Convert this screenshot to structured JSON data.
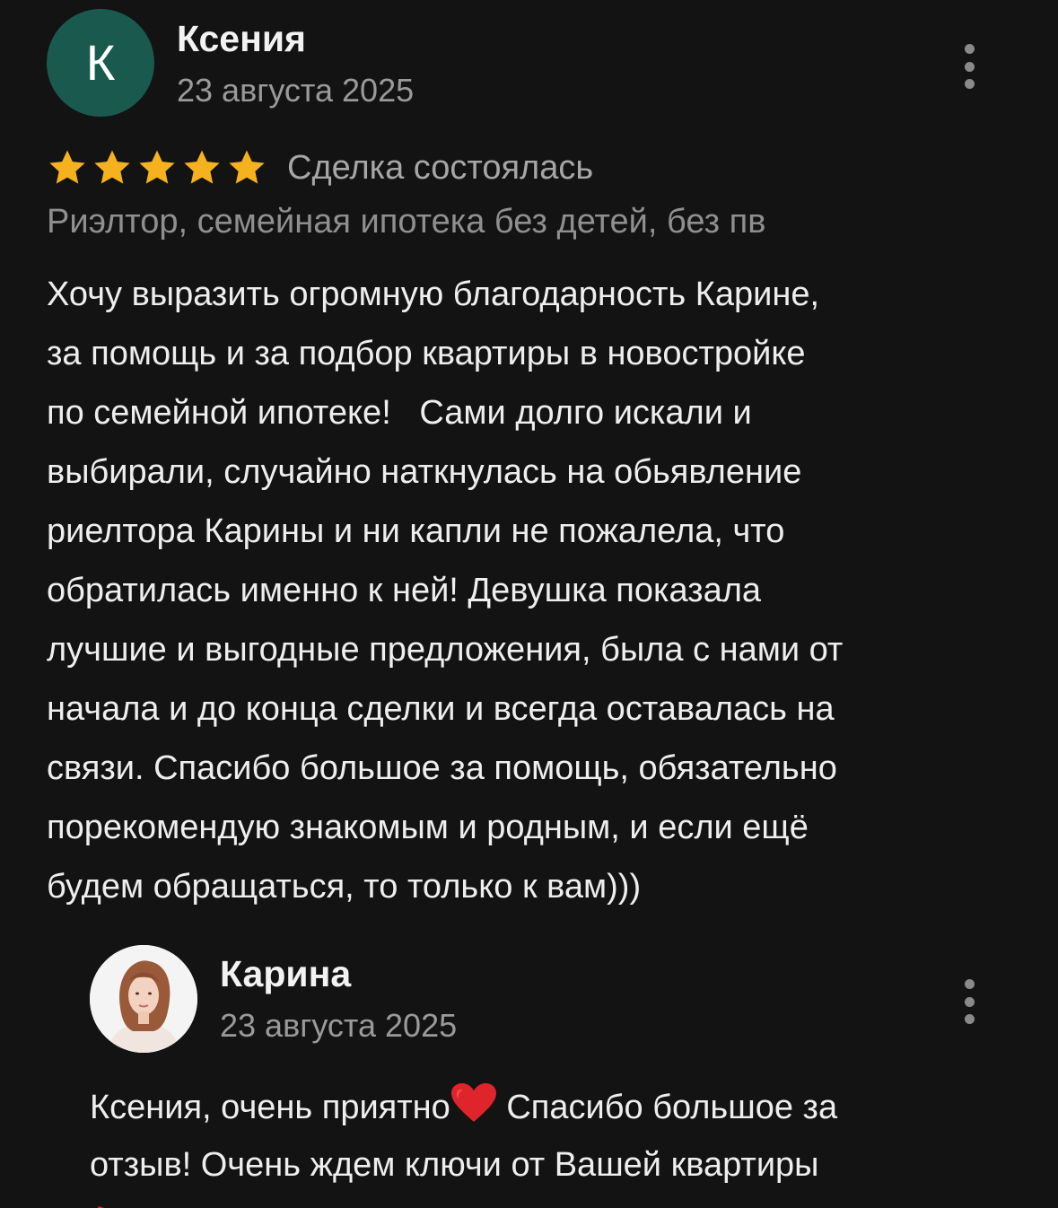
{
  "review": {
    "avatar_letter": "К",
    "author": "Ксения",
    "date": "23 августа 2025",
    "rating": 5,
    "rating_max": 5,
    "status": "Сделка состоялась",
    "subtitle": "Риэлтор, семейная ипотека без детей, без пв",
    "text_lines": [
      "Хочу выразить огромную благодарность Карине,",
      "за помощь и за подбор квартиры в новостройке",
      "по семейной ипотеке!   Сами долго искали и",
      "выбирали, случайно наткнулась на обьявление",
      "риелтора Карины и ни капли не пожалела, что",
      "обратилась именно к ней! Девушка показала",
      "лучшие и выгодные предложения, была с нами от",
      "начала и до конца сделки и всегда оставалась на",
      "связи. Спасибо большое за помощь, обязательно",
      "порекомендую знакомым и родным, и если ещё",
      "будем обращаться, то только к вам)))"
    ]
  },
  "reply": {
    "author": "Карина",
    "date": "23 августа 2025",
    "text_line1_before_emoji": "Ксения, очень приятно",
    "text_line1_after_emoji": " Спасибо большое за",
    "text_line2": "отзыв! Очень ждем ключи от Вашей квартиры"
  },
  "icons": {
    "star": "star-icon",
    "more": "more-vertical-icon",
    "heart": "red-heart-emoji"
  },
  "colors": {
    "background": "#131313",
    "avatar_bg": "#1a5a4e",
    "star": "#f6b11e",
    "heart": "#e0242c",
    "text_primary": "#eeeeee",
    "text_secondary": "#9a9a9a"
  }
}
